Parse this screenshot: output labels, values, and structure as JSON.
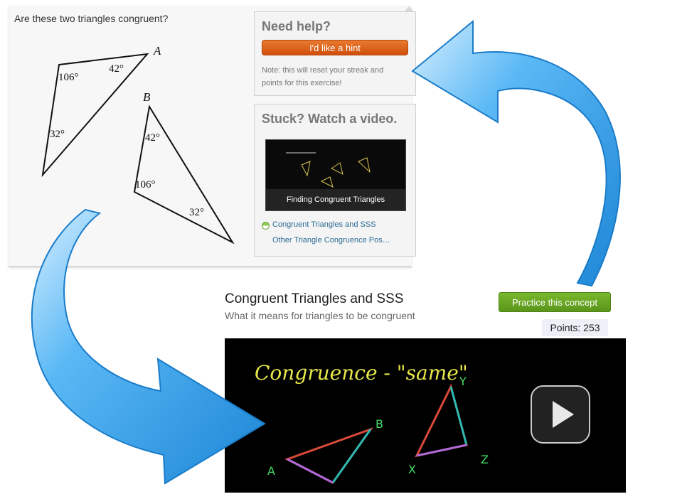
{
  "exercise": {
    "question": "Are these two triangles congruent?",
    "triangle_a": {
      "name": "A",
      "angle_1": "106°",
      "angle_2": "42°",
      "angle_3": "32°"
    },
    "triangle_b": {
      "name": "B",
      "angle_1": "42°",
      "angle_2": "106°",
      "angle_3": "32°"
    }
  },
  "help": {
    "title": "Need help?",
    "hint_button": "I'd like a hint",
    "note": "Note: this will reset your streak and points for this exercise!"
  },
  "stuck": {
    "title": "Stuck? Watch a video.",
    "thumbnail_caption": "Finding Congruent Triangles",
    "links": [
      "Congruent Triangles and SSS",
      "Other Triangle Congruence Pos…"
    ]
  },
  "lesson": {
    "title": "Congruent Triangles and SSS",
    "subtitle": "What it means for triangles to be congruent",
    "practice_button": "Practice this concept",
    "points": "Points: 253"
  },
  "video_chalkboard": {
    "heading": "Congruence - \"same\"",
    "vertex_labels": [
      "A",
      "B",
      "X",
      "Y",
      "Z"
    ]
  },
  "colors": {
    "hint_orange": "#d8560f",
    "practice_green": "#5a951a",
    "arrow_blue": "#2e9fe8",
    "link_blue": "#2b6b95",
    "chalk_yellow": "#e8e84a"
  },
  "icons": [
    "play-icon",
    "watched-circle-icon",
    "curved-arrow-icon"
  ]
}
